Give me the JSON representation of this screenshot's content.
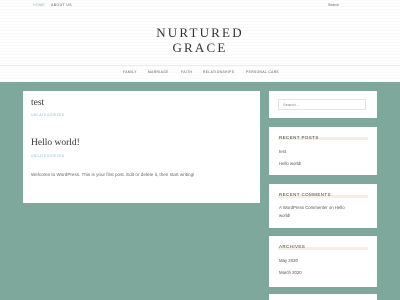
{
  "topbar": {
    "links": [
      {
        "label": "Home"
      },
      {
        "label": "About Us"
      }
    ],
    "search_placeholder": "Search"
  },
  "site": {
    "title_line1": "NURTURED",
    "title_line2": "GRACE"
  },
  "nav": {
    "items": [
      {
        "label": "Family"
      },
      {
        "label": "Marriage"
      },
      {
        "label": "Faith"
      },
      {
        "label": "Relationships"
      },
      {
        "label": "Personal Care"
      }
    ]
  },
  "posts": [
    {
      "title": "test",
      "category": "Uncategorized"
    },
    {
      "title": "Hello world!",
      "category": "Uncategorized",
      "excerpt": "Welcome to WordPress. This is your first post. Edit or delete it, then start writing!"
    }
  ],
  "sidebar": {
    "search_placeholder": "Search ...",
    "recent_posts": {
      "title": "Recent Posts",
      "items": [
        "test",
        "Hello world!"
      ]
    },
    "recent_comments": {
      "title": "Recent Comments",
      "author": "A WordPress Commenter",
      "on": "on",
      "post": "Hello",
      "post_cont": "world!"
    },
    "archives": {
      "title": "Archives",
      "items": [
        "May 2020",
        "March 2020"
      ]
    }
  },
  "colors": {
    "background": "#7fa89d",
    "accent": "#7fb0ba",
    "panel": "#ffffff"
  }
}
